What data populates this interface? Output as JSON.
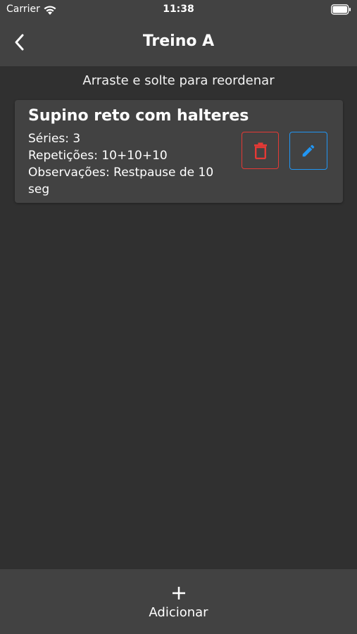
{
  "status_bar": {
    "carrier": "Carrier",
    "time": "11:38"
  },
  "app_bar": {
    "title": "Treino A",
    "back_icon": "chevron-left-icon"
  },
  "hint": "Arraste e solte para reordenar",
  "exercises": [
    {
      "name": "Supino reto com halteres",
      "series": "Séries: 3",
      "reps": "Repetições: 10+10+10",
      "notes": "Observações: Restpause de 10 seg",
      "delete_icon": "trash-icon",
      "edit_icon": "pencil-icon"
    }
  ],
  "bottom_bar": {
    "add_label": "Adicionar",
    "add_icon": "plus-icon"
  },
  "colors": {
    "background": "#303030",
    "surface": "#424242",
    "delete": "#e53935",
    "edit": "#2196f3"
  }
}
